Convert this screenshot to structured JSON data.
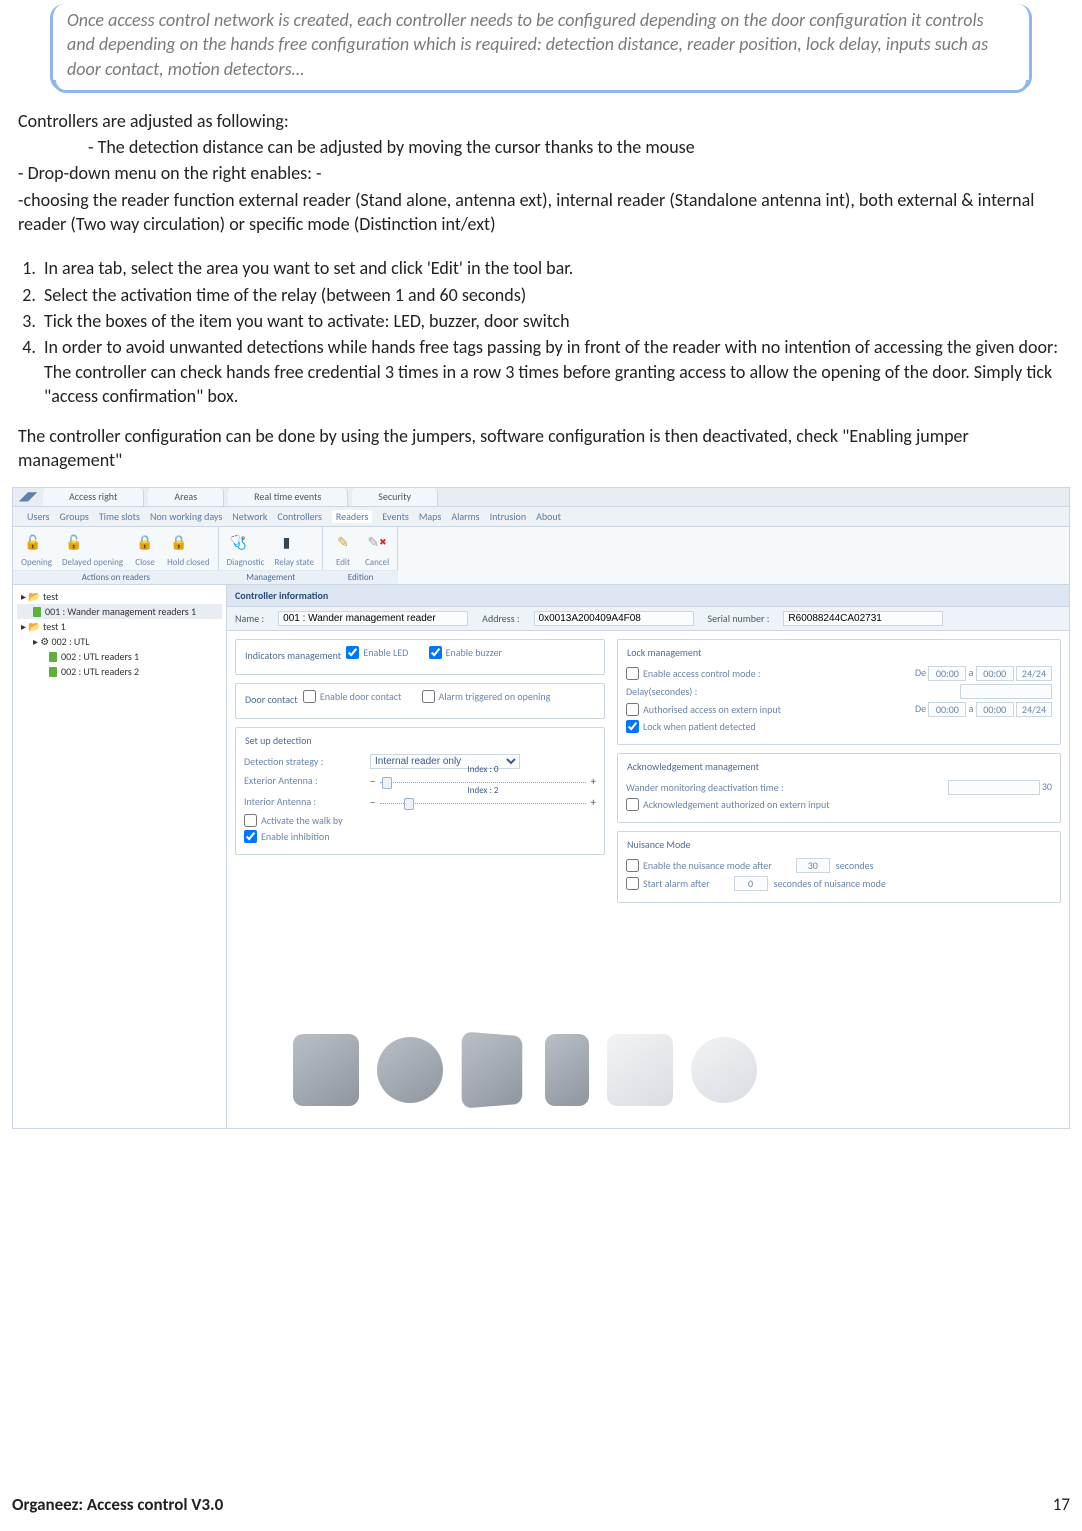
{
  "note": "Once access control network is created, each controller needs to be configured depending on the door configuration it controls and depending on the hands free configuration which is required: detection distance, reader position, lock delay, inputs such as door contact, motion detectors…",
  "intro": "Controllers are adjusted as following:",
  "bullet_detection": "- The detection distance can be adjusted by moving the cursor thanks to the mouse",
  "bullet_dropdown": "- Drop-down menu on the right enables: -",
  "bullet_reader": "-choosing the reader function external reader (Stand alone, antenna ext), internal reader (Standalone antenna int), both external & internal reader (Two way circulation) or specific mode (Distinction int/ext)",
  "steps": [
    "In area tab, select the area you want to set and click 'Edit' in the tool bar.",
    "Select  the activation time of the relay (between 1 and 60 seconds)",
    "Tick the boxes of the item you want to activate: LED, buzzer, door switch",
    "In order to avoid unwanted detections while hands free tags passing by in front of the reader with no intention of accessing the given door: The controller can check hands free credential 3 times in a row 3 times before granting access  to allow the opening of the door. Simply tick \"access confirmation\" box."
  ],
  "jumper": "The controller configuration can be done by using the jumpers, software configuration is then deactivated, check \"Enabling jumper management\"",
  "app": {
    "top_tabs": [
      "Access right",
      "Areas",
      "Real time events",
      "Security"
    ],
    "menu": [
      "Users",
      "Groups",
      "Time slots",
      "Non working days",
      "Network",
      "Controllers",
      "Readers",
      "Events",
      "Maps",
      "Alarms",
      "Intrusion",
      "About"
    ],
    "ribbon": {
      "group1": {
        "items": [
          "Opening",
          "Delayed opening",
          "Close",
          "Hold closed"
        ],
        "caption": "Actions on readers"
      },
      "group2": {
        "items": [
          "Diagnostic",
          "Relay state"
        ],
        "caption": "Management"
      },
      "group3": {
        "items": [
          "Edit",
          "Cancel"
        ],
        "caption": "Edition"
      }
    },
    "tree": {
      "root": "test",
      "n1": "001 : Wander management readers 1",
      "n2": "test 1",
      "n3": "002 : UTL",
      "n4": "002 : UTL readers 1",
      "n5": "002 : UTL readers 2"
    },
    "header": {
      "title": "Controller information",
      "name_lbl": "Name :",
      "name_val": "001 : Wander management reader",
      "addr_lbl": "Address :",
      "addr_val": "0x0013A200409A4F08",
      "serial_lbl": "Serial number :",
      "serial_val": "R60088244CA02731"
    },
    "indicators": {
      "legend": "Indicators management",
      "led": "Enable LED",
      "buzzer": "Enable buzzer"
    },
    "door": {
      "legend": "Door contact",
      "enable": "Enable door contact",
      "alarm": "Alarm triggered on opening"
    },
    "setup": {
      "legend": "Set up detection",
      "strategy_lbl": "Detection strategy :",
      "strategy_val": "Internal reader only",
      "ext_lbl": "Exterior Antenna :",
      "ext_idx": "Index : 0",
      "int_lbl": "Interior Antenna :",
      "int_idx": "Index : 2",
      "walkby": "Activate the walk by",
      "inhib": "Enable inhibition"
    },
    "lock": {
      "legend": "Lock management",
      "enable": "Enable access control mode :",
      "delay": "Delay(secondes) :",
      "auth": "Authorised access on extern input",
      "lockwhen": "Lock when patient detected",
      "time_pre": "De",
      "time_h1": "00:00",
      "time_a": "a",
      "time_h2": "00:00",
      "time_mode": "24/24"
    },
    "ack": {
      "legend": "Acknowledgement management",
      "deact": "Wander monitoring deactivation time :",
      "auth": "Acknowledgement authorized on extern input",
      "val": "30"
    },
    "nuisance": {
      "legend": "Nuisance Mode",
      "enable": "Enable the nuisance mode after",
      "enable_val": "30",
      "sec": "secondes",
      "start": "Start alarm after",
      "start_val": "0",
      "sec2": "secondes of nuisance mode"
    }
  },
  "footer": {
    "left": "Organeez: Access control     V3.0",
    "right": "17"
  },
  "chart_data": null
}
